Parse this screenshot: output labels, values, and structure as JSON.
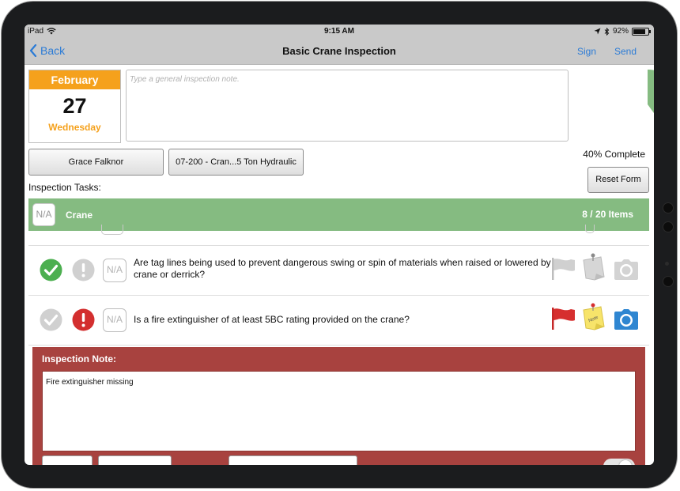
{
  "status_bar": {
    "device": "iPad",
    "time": "9:15 AM",
    "battery_percent": "92%",
    "battery_level": 0.92
  },
  "nav": {
    "back_label": "Back",
    "title": "Basic Crane Inspection",
    "sign_label": "Sign",
    "send_label": "Send"
  },
  "date": {
    "month": "February",
    "day": "27",
    "weekday": "Wednesday"
  },
  "general_note": {
    "value": "",
    "placeholder": "Type a general inspection note."
  },
  "progress": {
    "fraction": 0.4,
    "label": "40% Complete",
    "color": "#85bb81"
  },
  "inspector": {
    "name": "Grace Falknor"
  },
  "equipment": {
    "label": "07-200 - Cran...5 Ton Hydraulic"
  },
  "reset_label": "Reset Form",
  "tasks_label": "Inspection Tasks:",
  "category": {
    "na_label": "N/A",
    "name": "Crane",
    "count": "8 / 20 Items",
    "color": "#85bb81"
  },
  "tasks": [
    {
      "question": "Are tag lines being used to prevent dangerous swing or spin of materials when raised or lowered by crane or derrick?",
      "status": "pass",
      "na_label": "N/A",
      "flagged": false,
      "has_note": false,
      "has_photo": false
    },
    {
      "question": "Is a fire extinguisher of at least 5BC rating provided on the crane?",
      "status": "fail",
      "na_label": "N/A",
      "flagged": true,
      "has_note": true,
      "has_photo": true,
      "note_sticker": "Note"
    }
  ],
  "inspection_note": {
    "header": "Inspection Note:",
    "value": "Fire extinguisher missing",
    "color": "#a8423f"
  },
  "colors": {
    "accent_blue": "#2b7bd6",
    "pass_green": "#4caf50",
    "fail_red": "#d32f2f",
    "month_orange": "#f5a11c",
    "flag_red": "#d62f2f",
    "camera_blue": "#2f86d1"
  }
}
